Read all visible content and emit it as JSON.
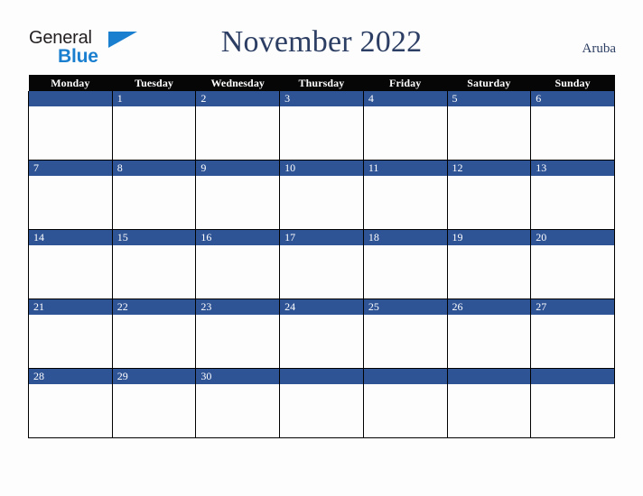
{
  "brand": {
    "name_part1": "General",
    "name_part2": "Blue",
    "triangle_color": "#1b7fd0",
    "text_color": "#231f20"
  },
  "header": {
    "title": "November 2022",
    "month": "November",
    "year": "2022",
    "country": "Aruba",
    "title_color": "#2c3e63"
  },
  "calendar": {
    "weekday_headers": [
      "Monday",
      "Tuesday",
      "Wednesday",
      "Thursday",
      "Friday",
      "Saturday",
      "Sunday"
    ],
    "header_bg": "#060606",
    "header_text": "#ffffff",
    "daynum_bg": "#2f5496",
    "daynum_text": "#ffffff",
    "cell_bg": "#fdfdfd",
    "border_color": "#000000",
    "weeks": [
      {
        "days": [
          {
            "number": "",
            "blank": true
          },
          {
            "number": "1",
            "blank": false
          },
          {
            "number": "2",
            "blank": false
          },
          {
            "number": "3",
            "blank": false
          },
          {
            "number": "4",
            "blank": false
          },
          {
            "number": "5",
            "blank": false
          },
          {
            "number": "6",
            "blank": false
          }
        ]
      },
      {
        "days": [
          {
            "number": "7",
            "blank": false
          },
          {
            "number": "8",
            "blank": false
          },
          {
            "number": "9",
            "blank": false
          },
          {
            "number": "10",
            "blank": false
          },
          {
            "number": "11",
            "blank": false
          },
          {
            "number": "12",
            "blank": false
          },
          {
            "number": "13",
            "blank": false
          }
        ]
      },
      {
        "days": [
          {
            "number": "14",
            "blank": false
          },
          {
            "number": "15",
            "blank": false
          },
          {
            "number": "16",
            "blank": false
          },
          {
            "number": "17",
            "blank": false
          },
          {
            "number": "18",
            "blank": false
          },
          {
            "number": "19",
            "blank": false
          },
          {
            "number": "20",
            "blank": false
          }
        ]
      },
      {
        "days": [
          {
            "number": "21",
            "blank": false
          },
          {
            "number": "22",
            "blank": false
          },
          {
            "number": "23",
            "blank": false
          },
          {
            "number": "24",
            "blank": false
          },
          {
            "number": "25",
            "blank": false
          },
          {
            "number": "26",
            "blank": false
          },
          {
            "number": "27",
            "blank": false
          }
        ]
      },
      {
        "days": [
          {
            "number": "28",
            "blank": false
          },
          {
            "number": "29",
            "blank": false
          },
          {
            "number": "30",
            "blank": false
          },
          {
            "number": "",
            "blank": true
          },
          {
            "number": "",
            "blank": true
          },
          {
            "number": "",
            "blank": true
          },
          {
            "number": "",
            "blank": true
          }
        ]
      }
    ]
  }
}
